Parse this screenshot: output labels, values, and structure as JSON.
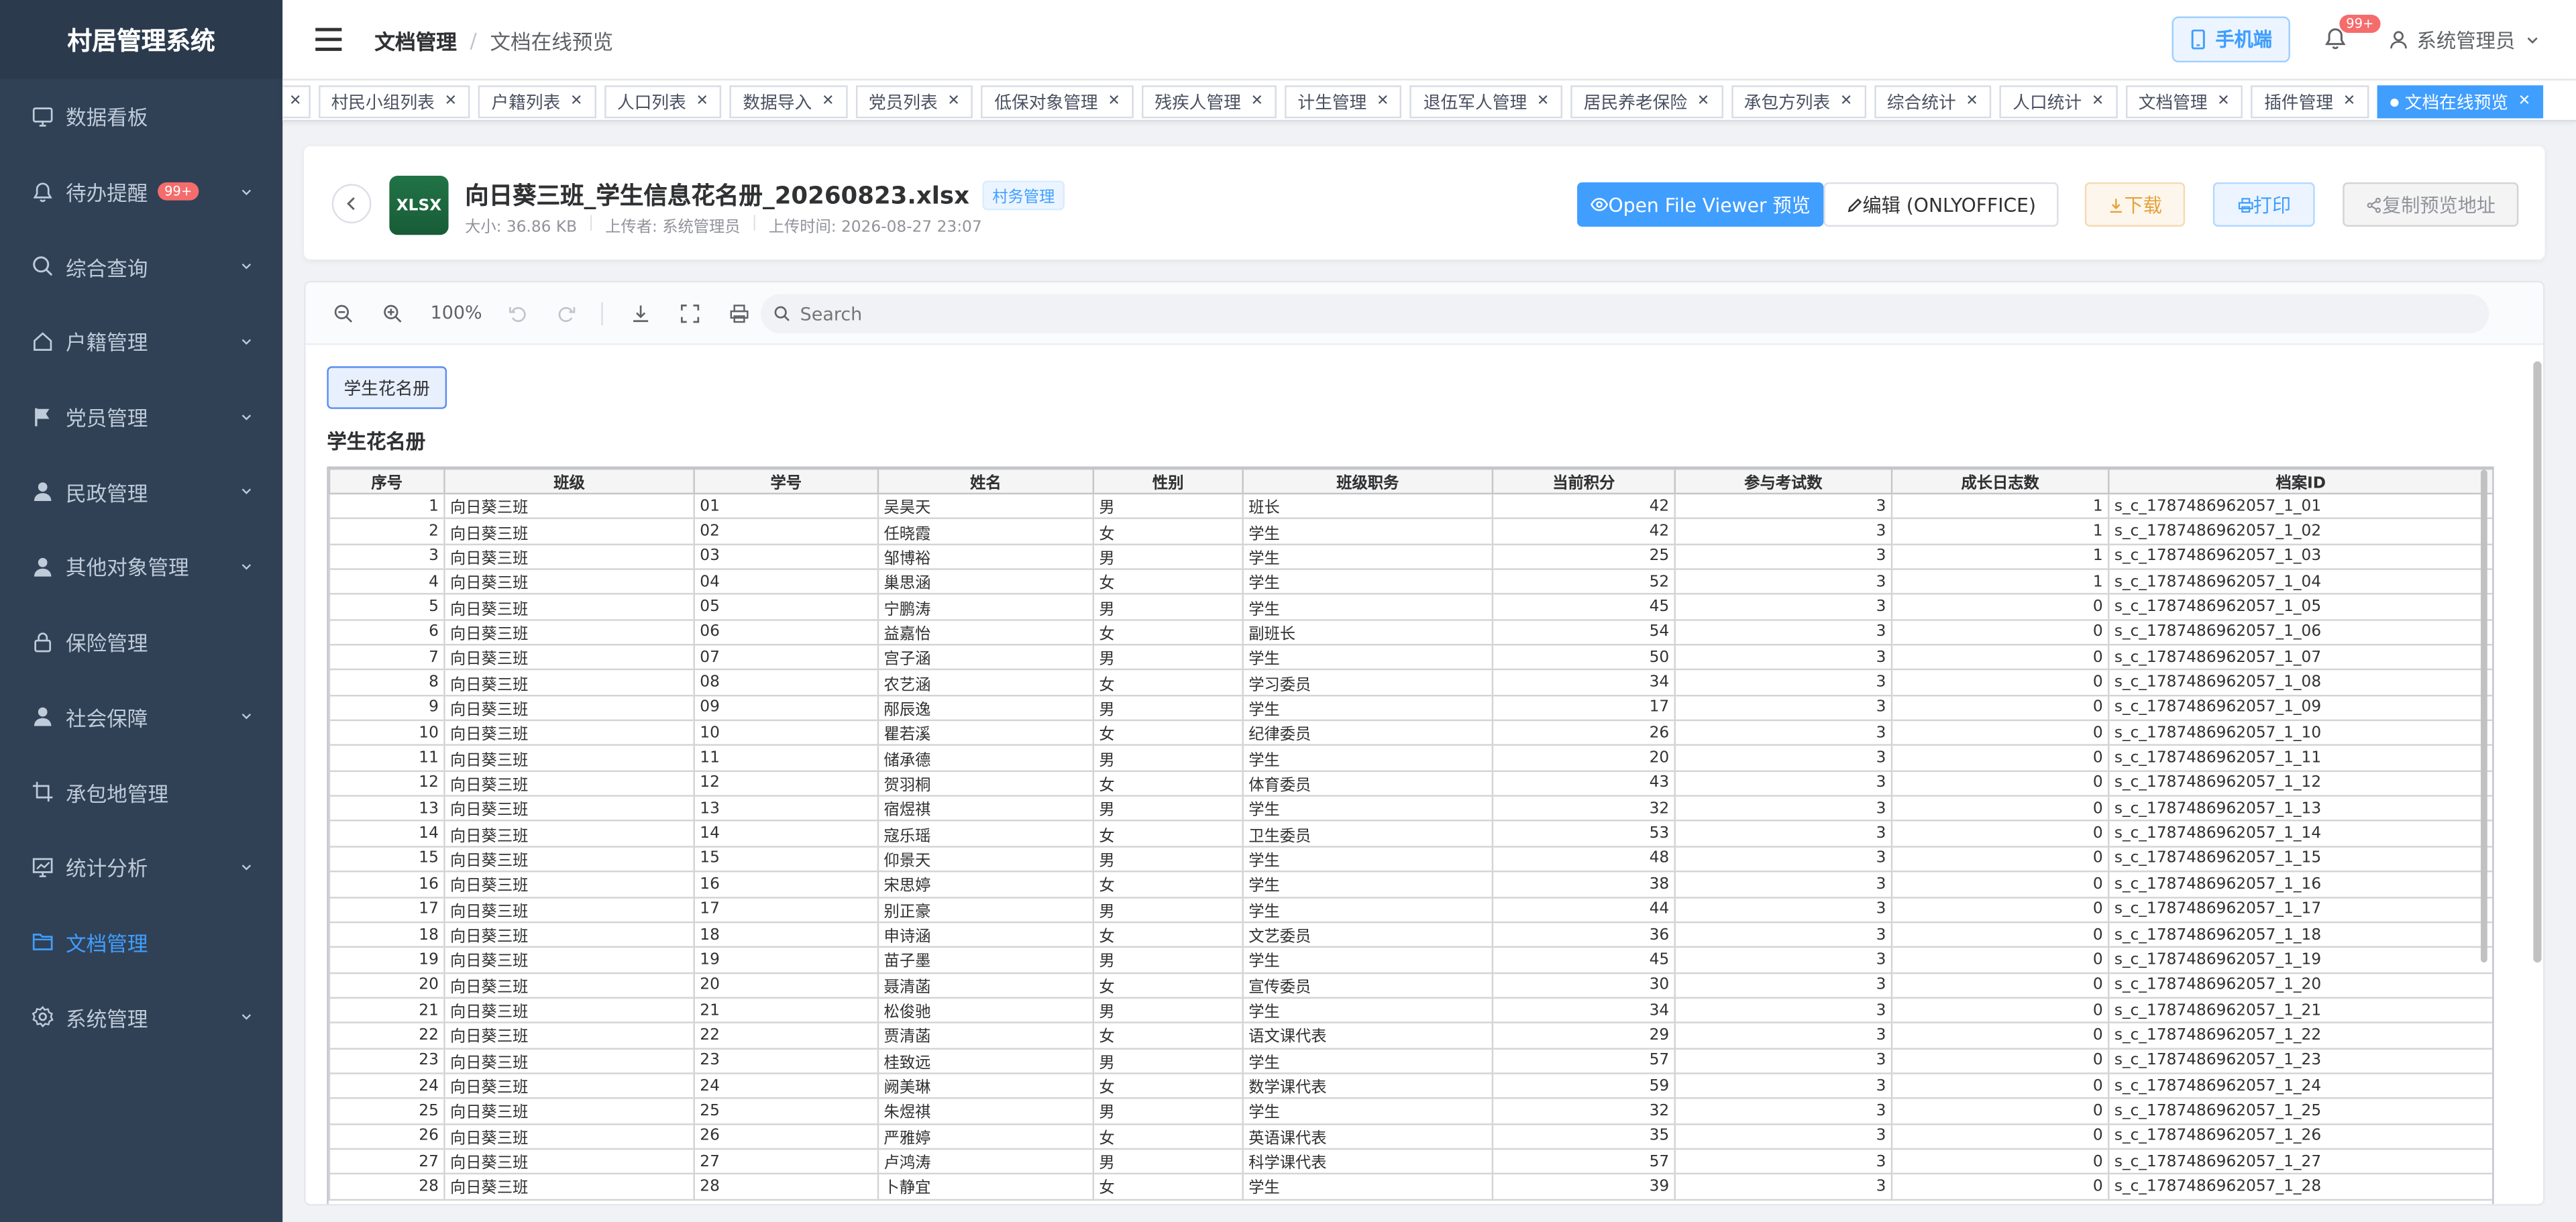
{
  "app_title": "村居管理系统",
  "sidebar": {
    "items": [
      {
        "label": "数据看板",
        "icon": "dashboard-icon",
        "arrow": false
      },
      {
        "label": "待办提醒",
        "icon": "bell-icon",
        "arrow": true,
        "badge": "99+"
      },
      {
        "label": "综合查询",
        "icon": "search-icon",
        "arrow": true
      },
      {
        "label": "户籍管理",
        "icon": "home-icon",
        "arrow": true
      },
      {
        "label": "党员管理",
        "icon": "flag-icon",
        "arrow": true
      },
      {
        "label": "民政管理",
        "icon": "user-icon",
        "arrow": true
      },
      {
        "label": "其他对象管理",
        "icon": "user-icon",
        "arrow": true
      },
      {
        "label": "保险管理",
        "icon": "lock-icon",
        "arrow": false
      },
      {
        "label": "社会保障",
        "icon": "user-icon",
        "arrow": true
      },
      {
        "label": "承包地管理",
        "icon": "crop-icon",
        "arrow": false
      },
      {
        "label": "统计分析",
        "icon": "chart-icon",
        "arrow": true
      },
      {
        "label": "文档管理",
        "icon": "folder-icon",
        "arrow": false,
        "active": true
      },
      {
        "label": "系统管理",
        "icon": "gear-icon",
        "arrow": true
      }
    ]
  },
  "header": {
    "breadcrumb": [
      "文档管理",
      "文档在线预览"
    ],
    "mobile_label": "手机端",
    "bell_count": "99+",
    "user_name": "系统管理员"
  },
  "tags": [
    "村民小组列表",
    "户籍列表",
    "人口列表",
    "数据导入",
    "党员列表",
    "低保对象管理",
    "残疾人管理",
    "计生管理",
    "退伍军人管理",
    "居民养老保险",
    "承包方列表",
    "综合统计",
    "人口统计",
    "文档管理",
    "插件管理",
    "文档在线预览"
  ],
  "active_tag": "文档在线预览",
  "file": {
    "icon_label": "XLSX",
    "name": "向日葵三班_学生信息花名册_20260823.xlsx",
    "category": "村务管理",
    "size": "大小: 36.86 KB",
    "uploader": "上传者: 系统管理员",
    "upload_time": "上传时间: 2026-08-27 23:07"
  },
  "actions": {
    "preview": "Open File Viewer 预览",
    "edit": "编辑 (ONLYOFFICE)",
    "download": "下载",
    "print": "打印",
    "copy_url": "复制预览地址"
  },
  "viewer": {
    "zoom": "100%",
    "search_placeholder": "Search",
    "sheet_tab": "学生花名册",
    "sheet_title": "学生花名册"
  },
  "table": {
    "headers": [
      "序号",
      "班级",
      "学号",
      "姓名",
      "性别",
      "班级职务",
      "当前积分",
      "参与考试数",
      "成长日志数",
      "档案ID"
    ],
    "rows": [
      [
        "1",
        "向日葵三班",
        "01",
        "吴昊天",
        "男",
        "班长",
        "42",
        "3",
        "1",
        "s_c_1787486962057_1_01"
      ],
      [
        "2",
        "向日葵三班",
        "02",
        "任晓霞",
        "女",
        "学生",
        "42",
        "3",
        "1",
        "s_c_1787486962057_1_02"
      ],
      [
        "3",
        "向日葵三班",
        "03",
        "邹博裕",
        "男",
        "学生",
        "25",
        "3",
        "1",
        "s_c_1787486962057_1_03"
      ],
      [
        "4",
        "向日葵三班",
        "04",
        "巢思涵",
        "女",
        "学生",
        "52",
        "3",
        "1",
        "s_c_1787486962057_1_04"
      ],
      [
        "5",
        "向日葵三班",
        "05",
        "宁鹏涛",
        "男",
        "学生",
        "45",
        "3",
        "0",
        "s_c_1787486962057_1_05"
      ],
      [
        "6",
        "向日葵三班",
        "06",
        "益嘉怡",
        "女",
        "副班长",
        "54",
        "3",
        "0",
        "s_c_1787486962057_1_06"
      ],
      [
        "7",
        "向日葵三班",
        "07",
        "宫子涵",
        "男",
        "学生",
        "50",
        "3",
        "0",
        "s_c_1787486962057_1_07"
      ],
      [
        "8",
        "向日葵三班",
        "08",
        "农艺涵",
        "女",
        "学习委员",
        "34",
        "3",
        "0",
        "s_c_1787486962057_1_08"
      ],
      [
        "9",
        "向日葵三班",
        "09",
        "邴辰逸",
        "男",
        "学生",
        "17",
        "3",
        "0",
        "s_c_1787486962057_1_09"
      ],
      [
        "10",
        "向日葵三班",
        "10",
        "瞿若溪",
        "女",
        "纪律委员",
        "26",
        "3",
        "0",
        "s_c_1787486962057_1_10"
      ],
      [
        "11",
        "向日葵三班",
        "11",
        "储承德",
        "男",
        "学生",
        "20",
        "3",
        "0",
        "s_c_1787486962057_1_11"
      ],
      [
        "12",
        "向日葵三班",
        "12",
        "贺羽桐",
        "女",
        "体育委员",
        "43",
        "3",
        "0",
        "s_c_1787486962057_1_12"
      ],
      [
        "13",
        "向日葵三班",
        "13",
        "宿煜祺",
        "男",
        "学生",
        "32",
        "3",
        "0",
        "s_c_1787486962057_1_13"
      ],
      [
        "14",
        "向日葵三班",
        "14",
        "寇乐瑶",
        "女",
        "卫生委员",
        "53",
        "3",
        "0",
        "s_c_1787486962057_1_14"
      ],
      [
        "15",
        "向日葵三班",
        "15",
        "仰景天",
        "男",
        "学生",
        "48",
        "3",
        "0",
        "s_c_1787486962057_1_15"
      ],
      [
        "16",
        "向日葵三班",
        "16",
        "宋思婷",
        "女",
        "学生",
        "38",
        "3",
        "0",
        "s_c_1787486962057_1_16"
      ],
      [
        "17",
        "向日葵三班",
        "17",
        "别正豪",
        "男",
        "学生",
        "44",
        "3",
        "0",
        "s_c_1787486962057_1_17"
      ],
      [
        "18",
        "向日葵三班",
        "18",
        "申诗涵",
        "女",
        "文艺委员",
        "36",
        "3",
        "0",
        "s_c_1787486962057_1_18"
      ],
      [
        "19",
        "向日葵三班",
        "19",
        "苗子墨",
        "男",
        "学生",
        "45",
        "3",
        "0",
        "s_c_1787486962057_1_19"
      ],
      [
        "20",
        "向日葵三班",
        "20",
        "聂清菡",
        "女",
        "宣传委员",
        "30",
        "3",
        "0",
        "s_c_1787486962057_1_20"
      ],
      [
        "21",
        "向日葵三班",
        "21",
        "松俊驰",
        "男",
        "学生",
        "34",
        "3",
        "0",
        "s_c_1787486962057_1_21"
      ],
      [
        "22",
        "向日葵三班",
        "22",
        "贾清菡",
        "女",
        "语文课代表",
        "29",
        "3",
        "0",
        "s_c_1787486962057_1_22"
      ],
      [
        "23",
        "向日葵三班",
        "23",
        "桂致远",
        "男",
        "学生",
        "57",
        "3",
        "0",
        "s_c_1787486962057_1_23"
      ],
      [
        "24",
        "向日葵三班",
        "24",
        "阙美琳",
        "女",
        "数学课代表",
        "59",
        "3",
        "0",
        "s_c_1787486962057_1_24"
      ],
      [
        "25",
        "向日葵三班",
        "25",
        "朱煜祺",
        "男",
        "学生",
        "32",
        "3",
        "0",
        "s_c_1787486962057_1_25"
      ],
      [
        "26",
        "向日葵三班",
        "26",
        "严雅婷",
        "女",
        "英语课代表",
        "35",
        "3",
        "0",
        "s_c_1787486962057_1_26"
      ],
      [
        "27",
        "向日葵三班",
        "27",
        "卢鸿涛",
        "男",
        "科学课代表",
        "57",
        "3",
        "0",
        "s_c_1787486962057_1_27"
      ],
      [
        "28",
        "向日葵三班",
        "28",
        "卜静宜",
        "女",
        "学生",
        "39",
        "3",
        "0",
        "s_c_1787486962057_1_28"
      ]
    ]
  }
}
